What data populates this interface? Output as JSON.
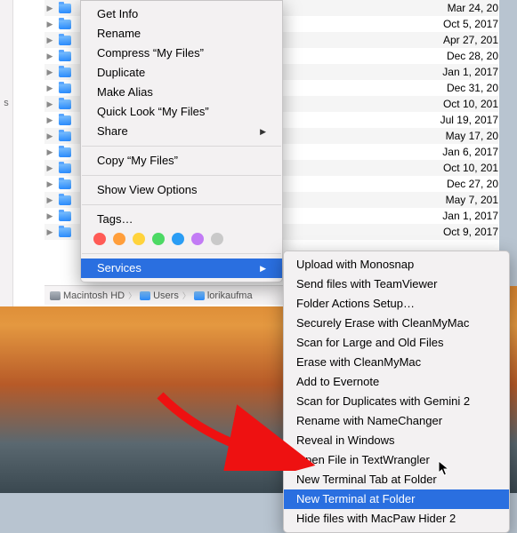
{
  "sidebar_label": "s",
  "rows": [
    {
      "date": "Mar 24, 20"
    },
    {
      "date": "Oct 5, 2017"
    },
    {
      "date": "Apr 27, 201"
    },
    {
      "date": "Dec 28, 20"
    },
    {
      "date": "Jan 1, 2017"
    },
    {
      "date": "Dec 31, 20"
    },
    {
      "date": "Oct 10, 201"
    },
    {
      "date": "Jul 19, 2017"
    },
    {
      "date": "May 17, 20"
    },
    {
      "date": "Jan 6, 2017"
    },
    {
      "date": "Oct 10, 201"
    },
    {
      "date": "Dec 27, 20"
    },
    {
      "date": "May 7, 201"
    },
    {
      "date": "Jan 1, 2017"
    },
    {
      "date": "Oct 9, 2017"
    }
  ],
  "ctx": {
    "get_info": "Get Info",
    "rename": "Rename",
    "compress": "Compress “My Files”",
    "duplicate": "Duplicate",
    "alias": "Make Alias",
    "quicklook": "Quick Look “My Files”",
    "share": "Share",
    "copy": "Copy “My Files”",
    "viewopts": "Show View Options",
    "tags": "Tags…",
    "services": "Services"
  },
  "tag_colors": [
    "#ff5b56",
    "#ff9e3b",
    "#ffd33c",
    "#4cd964",
    "#2a9df4",
    "#c27bf5",
    "#c9c9c9"
  ],
  "services": {
    "items": [
      "Upload with Monosnap",
      "Send files with TeamViewer",
      "Folder Actions Setup…",
      "Securely Erase with CleanMyMac",
      "Scan for Large and Old Files",
      "Erase with CleanMyMac",
      "Add to Evernote",
      "Scan for Duplicates with Gemini 2",
      "Rename with NameChanger",
      "Reveal in Windows",
      "Open File in TextWrangler",
      "New Terminal Tab at Folder",
      "New Terminal at Folder",
      "Hide files with MacPaw Hider 2"
    ],
    "highlight_index": 12
  },
  "path": {
    "p0": "Macintosh HD",
    "p1": "Users",
    "p2": "lorikaufma"
  }
}
